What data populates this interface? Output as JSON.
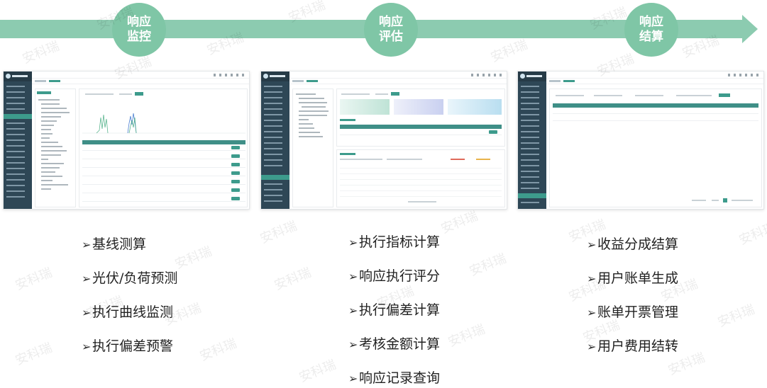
{
  "stages": [
    {
      "label": "响应\n监控",
      "lines": [
        "响应",
        "监控"
      ]
    },
    {
      "label": "响应\n评估",
      "lines": [
        "响应",
        "评估"
      ]
    },
    {
      "label": "响应\n结算",
      "lines": [
        "响应",
        "结算"
      ]
    }
  ],
  "columns": [
    {
      "items": [
        "基线测算",
        "光伏/负荷预测",
        "执行曲线监测",
        "执行偏差预警"
      ]
    },
    {
      "items": [
        "执行指标计算",
        "响应执行评分",
        "执行偏差计算",
        "考核金额计算",
        "响应记录查询"
      ]
    },
    {
      "items": [
        "收益分成结算",
        "用户账单生成",
        "账单开票管理",
        "用户费用结转"
      ]
    }
  ],
  "bullet": "➢",
  "watermark": "安科瑞",
  "colors": {
    "band": "#8ccbb0",
    "circle": "#7fc6a6",
    "sidebar": "#2e4756",
    "accent": "#3d9b8c"
  }
}
